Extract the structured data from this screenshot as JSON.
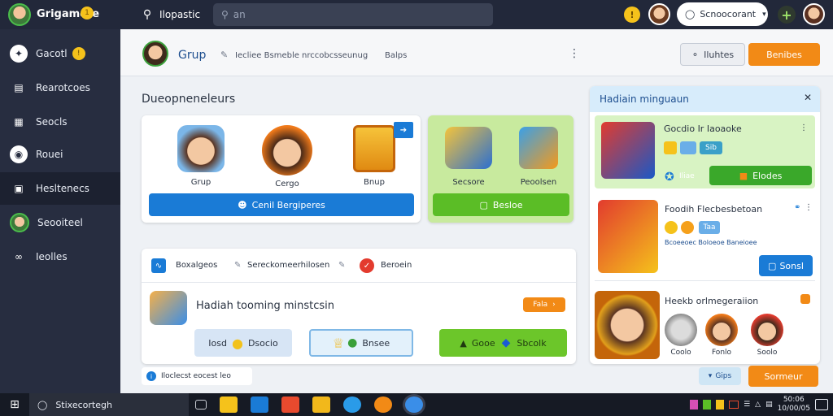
{
  "topbar": {
    "app_title": "Grigamete",
    "title_badge": "1",
    "search_label": "Ilopastic",
    "search_placeholder": "an",
    "notify_badge": "!",
    "account_button": "Scnoocorant",
    "add_label": "+"
  },
  "sidebar": {
    "items": [
      {
        "label": "Gacotl",
        "icon": "wrench-icon",
        "badge": "!"
      },
      {
        "label": "Rearotcoes",
        "icon": "chart-icon"
      },
      {
        "label": "Seocls",
        "icon": "grid-icon"
      },
      {
        "label": "Rouei",
        "icon": "target-icon"
      },
      {
        "label": "Hesltenecs",
        "icon": "folder-icon"
      },
      {
        "label": "Seooiteel",
        "icon": "avatar-icon"
      },
      {
        "label": "Ieolles",
        "icon": "link-icon"
      }
    ]
  },
  "header": {
    "group_label": "Grup",
    "breadcrumb": "Iecliee Bsmeble nrccobcsseunug",
    "breadcrumb_tail": "Balps",
    "secondary_button": "Iluhtes",
    "primary_button": "Benibes"
  },
  "section_title": "Dueopneneleurs",
  "avatar_card": {
    "items": [
      {
        "label": "Grup"
      },
      {
        "label": "Cergo"
      },
      {
        "label": "Bnup"
      }
    ],
    "action": "Cenil Bergiperes"
  },
  "green_card": {
    "items": [
      {
        "label": "Secsore"
      },
      {
        "label": "Peoolsen"
      }
    ],
    "action": "Besloe"
  },
  "mission_panel": {
    "tab1": "Boxalgeos",
    "tab2": "Sereckomeerhilosen",
    "tab3": "Beroein",
    "title": "Hadiah tooming minstcsin",
    "tag": "Fala",
    "options": [
      {
        "label": "Iosd",
        "sublabel": "Dsocio"
      },
      {
        "label": "Bnsee"
      },
      {
        "label": "Gooe",
        "sublabel": "Sbcolk"
      }
    ]
  },
  "bottom_tag": "Iloclecst eocest leo",
  "right_panel": {
    "title": "Hadiain minguaun",
    "card1": {
      "title": "Gocdio Ir Iaoaoke",
      "chip": "Sib",
      "sub": "Iliae",
      "action": "Elodes"
    },
    "card2": {
      "title": "Foodih Flecbesbetoan",
      "chip": "Taa",
      "sub": "Bcoeeoec Boloeoe Baneioee",
      "action": "Sonsl"
    },
    "card3": {
      "title": "Heekb orlmegeraiion",
      "avatars": [
        {
          "label": "Coolo"
        },
        {
          "label": "Fonlo"
        },
        {
          "label": "Soolo"
        }
      ]
    }
  },
  "footer": {
    "small_button": "Gips",
    "primary_button": "Sormeur"
  },
  "taskbar": {
    "search_text": "Stixecortegh",
    "time": "50:06",
    "date": "10/00/05"
  },
  "colors": {
    "topbar": "#22283a",
    "sidebar": "#272d40",
    "accent_blue": "#1a7bd6",
    "accent_green": "#5bbd26",
    "accent_orange": "#f28a16"
  }
}
